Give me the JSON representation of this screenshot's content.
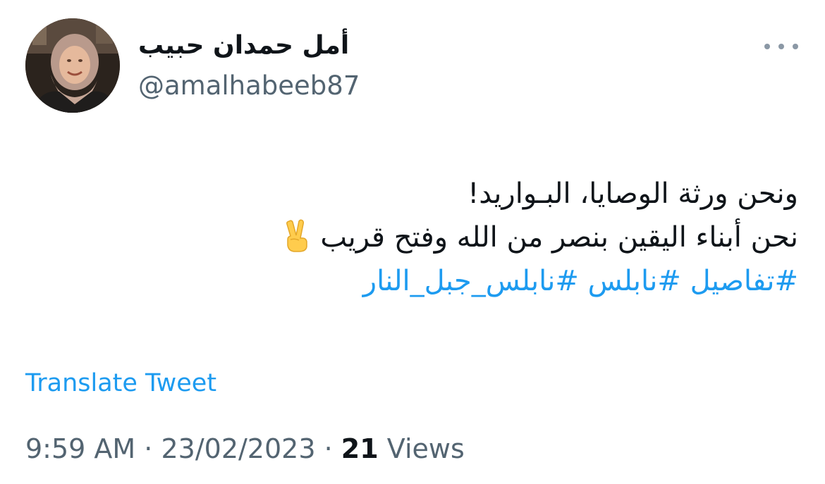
{
  "author": {
    "display_name": "أمل حمدان حبيب",
    "handle": "@amalhabeeb87"
  },
  "tweet": {
    "lines": [
      "ونحن ورثة الوصايا، البـواريد!",
      "نحن أبناء اليقين بنصر من الله وفتح قريب"
    ],
    "emoji": "victory-hand-icon",
    "hashtags": [
      "#تفاصيل",
      "#نابلس",
      "#نابلس_جبل_النار"
    ]
  },
  "translate_label": "Translate Tweet",
  "meta": {
    "time": "9:59 AM",
    "separator": "·",
    "date": "23/02/2023",
    "views_count": "21",
    "views_label": "Views"
  },
  "colors": {
    "accent": "#1d9bf0",
    "secondary_text": "#536471",
    "primary_text": "#0f1419"
  }
}
